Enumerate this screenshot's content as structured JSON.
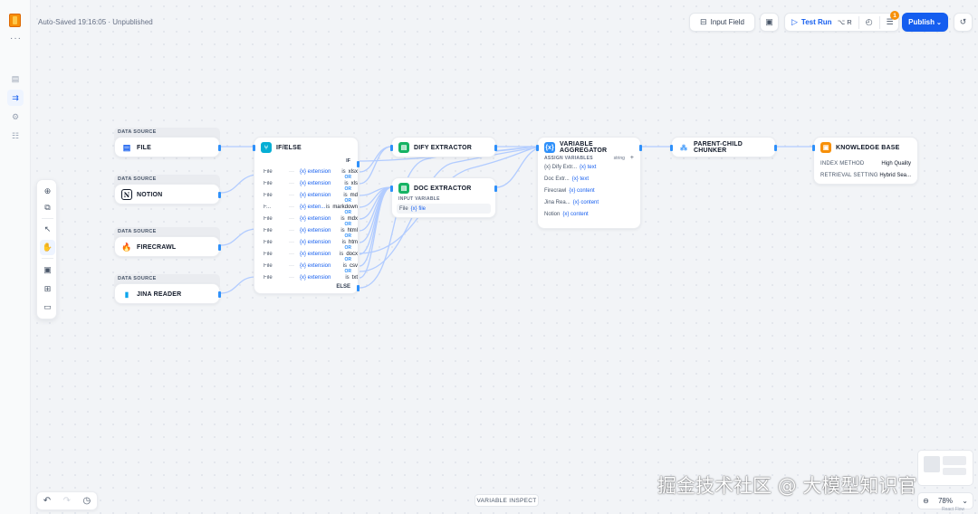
{
  "header": {
    "autosave_text": "Auto-Saved 19:16:05 · Unpublished",
    "input_field_label": "Input Field",
    "test_run_label": "Test Run",
    "test_run_shortcut": "⌥ R",
    "checklist_badge": "1",
    "publish_label": "Publish"
  },
  "canvas": {
    "variable_inspect_label": "VARIABLE INSPECT",
    "zoom_level": "78%",
    "watermark": "掘金技术社区 @ 大模型知识官",
    "watermark_small": "React Flow"
  },
  "data_sources": [
    {
      "section_label": "DATA SOURCE",
      "title": "FILE"
    },
    {
      "section_label": "DATA SOURCE",
      "title": "NOTION"
    },
    {
      "section_label": "DATA SOURCE",
      "title": "FIRECRAWL"
    },
    {
      "section_label": "DATA SOURCE",
      "title": "JINA READER"
    }
  ],
  "ifelse": {
    "title": "IF/ELSE",
    "port_label": "IF",
    "else_label": "ELSE",
    "conditions": [
      {
        "field": "File",
        "var": "{x} extension",
        "op": "is",
        "value": "xlsx"
      },
      {
        "field": "File",
        "var": "{x} extension",
        "op": "is",
        "value": "xls"
      },
      {
        "field": "File",
        "var": "{x} extension",
        "op": "is",
        "value": "md"
      },
      {
        "field": "F...",
        "var": "{x} exten...",
        "op": "is",
        "value": "markdown"
      },
      {
        "field": "File",
        "var": "{x} extension",
        "op": "is",
        "value": "mdx"
      },
      {
        "field": "File",
        "var": "{x} extension",
        "op": "is",
        "value": "html"
      },
      {
        "field": "File",
        "var": "{x} extension",
        "op": "is",
        "value": "htm"
      },
      {
        "field": "File",
        "var": "{x} extension",
        "op": "is",
        "value": "docx"
      },
      {
        "field": "File",
        "var": "{x} extension",
        "op": "is",
        "value": "csv"
      },
      {
        "field": "File",
        "var": "{x} extension",
        "op": "is",
        "value": "txt"
      }
    ],
    "or_label": "OR"
  },
  "dify_extractor": {
    "title": "DIFY EXTRACTOR"
  },
  "doc_extractor": {
    "title": "DOC EXTRACTOR",
    "input_label": "INPUT VARIABLE",
    "input_field": "File",
    "input_var": "{x} file"
  },
  "aggregator": {
    "title": "VARIABLE AGGREGATOR",
    "assign_label": "ASSIGN VARIABLES",
    "type_label": "string",
    "plus": "+",
    "rows": [
      {
        "src": "{x} Dify Extr...",
        "var": "{x} text"
      },
      {
        "src": "Doc Extr...",
        "var": "{x} text"
      },
      {
        "src": "Firecrawl",
        "var": "{x} content"
      },
      {
        "src": "Jina Rea...",
        "var": "{x} content"
      },
      {
        "src": "Notion",
        "var": "{x} content"
      }
    ]
  },
  "chunker": {
    "title": "PARENT-CHILD CHUNKER"
  },
  "knowledge_base": {
    "title": "KNOWLEDGE BASE",
    "rows": [
      {
        "key": "INDEX METHOD",
        "value": "High Quality"
      },
      {
        "key": "RETRIEVAL SETTING",
        "value": "Hybrid Sea..."
      }
    ]
  },
  "colors": {
    "accent": "#155eef",
    "edge": "#b2ccff",
    "port": "#2e90fa",
    "ifelse_icon": "#06aed4",
    "extractor_icon": "#16b364",
    "kb_icon": "#f79009"
  }
}
